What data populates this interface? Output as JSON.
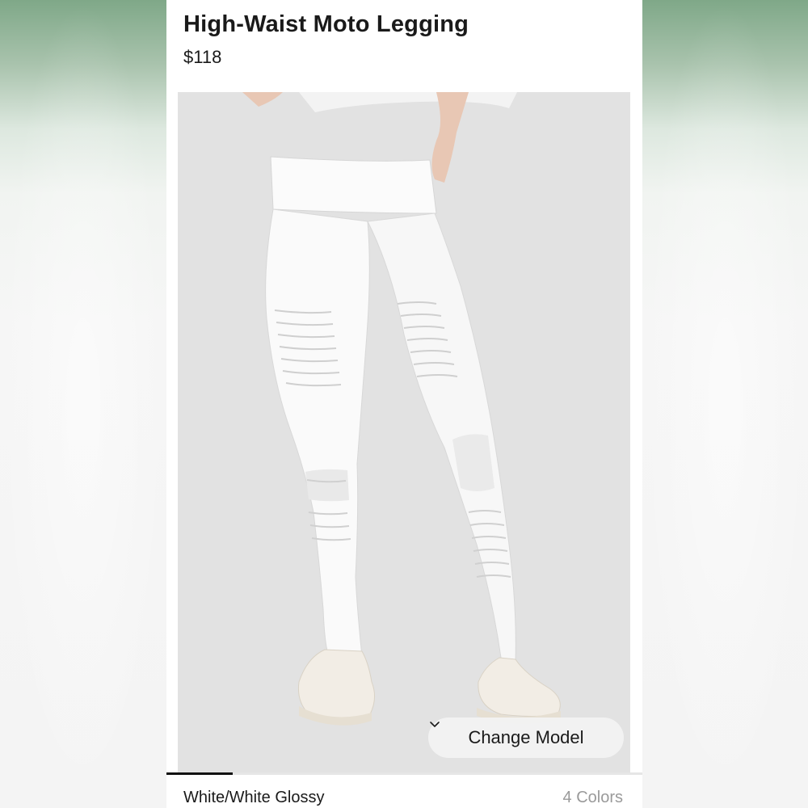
{
  "product": {
    "title": "High-Waist Moto Legging",
    "price": "$118"
  },
  "hero": {
    "image_subject": "model wearing white moto leggings and white sneakers",
    "change_model_label": "Change Model",
    "change_model_icon": "chevron-down-icon"
  },
  "carousel": {
    "active_index_fraction": 0.14
  },
  "variant": {
    "color_name": "White/White Glossy",
    "color_count": "4 Colors"
  },
  "colors": {
    "background_top": "#7fa888",
    "hero_bg": "#e4e4e4",
    "text": "#1a1a1a",
    "muted": "#9a9a9a"
  }
}
